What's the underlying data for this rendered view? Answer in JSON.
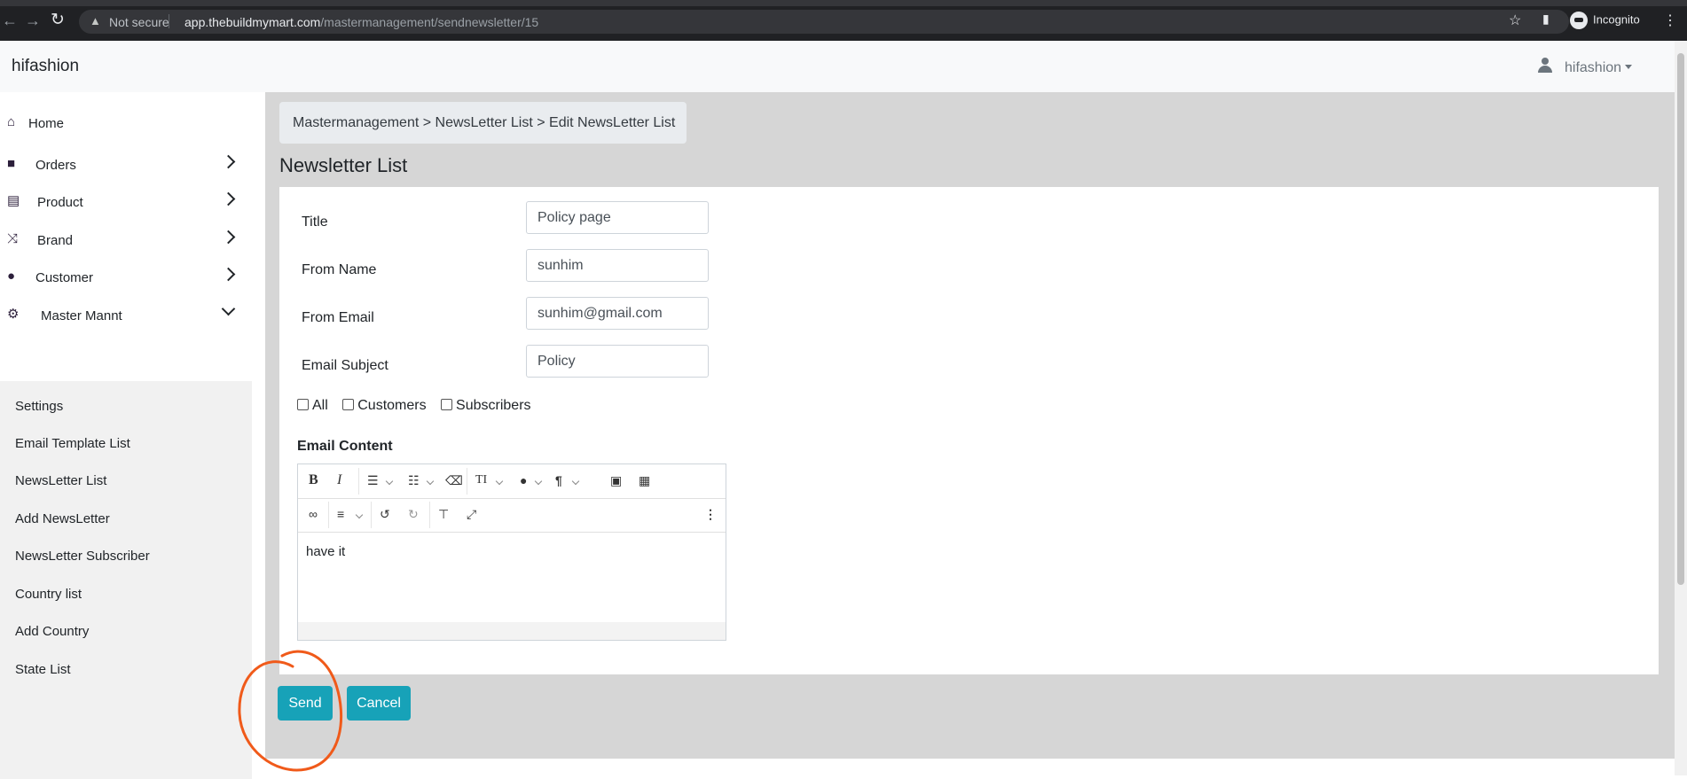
{
  "browser": {
    "security_label": "Not secure",
    "url_host": "app.thebuildmymart.com",
    "url_path": "/mastermanagement/sendnewsletter/15",
    "profile_label": "Incognito"
  },
  "topbar": {
    "brand": "hifashion",
    "user_name": "hifashion"
  },
  "sidebar": {
    "items": [
      {
        "label": "Home",
        "icon": "home-icon"
      },
      {
        "label": "Orders",
        "icon": "bag-icon"
      },
      {
        "label": "Product",
        "icon": "archive-icon"
      },
      {
        "label": "Brand",
        "icon": "shuffle-icon"
      },
      {
        "label": "Customer",
        "icon": "user-icon"
      },
      {
        "label": "Master Mannt",
        "icon": "user-gear-icon"
      }
    ],
    "submenu": [
      "Settings",
      "Email Template List",
      "NewsLetter List",
      "Add NewsLetter",
      "NewsLetter Subscriber",
      "Country list",
      "Add Country",
      "State List"
    ]
  },
  "breadcrumb": {
    "text": "Mastermanagement > NewsLetter List > Edit NewsLetter List"
  },
  "page": {
    "title": "Newsletter List"
  },
  "form": {
    "title_label": "Title",
    "title_value": "Policy page",
    "from_name_label": "From Name",
    "from_name_value": "sunhim",
    "from_email_label": "From Email",
    "from_email_value": "sunhim@gmail.com",
    "subject_label": "Email Subject",
    "subject_value": "Policy",
    "recipients": [
      {
        "label": "All",
        "checked": false
      },
      {
        "label": "Customers",
        "checked": false
      },
      {
        "label": "Subscribers",
        "checked": false
      }
    ],
    "content_label": "Email Content",
    "content_value": "have it"
  },
  "actions": {
    "send_label": "Send",
    "cancel_label": "Cancel"
  },
  "colors": {
    "accent": "#17a2b8",
    "annotation": "#f05a1a",
    "sidebar_icon": "#2c1f3b"
  }
}
